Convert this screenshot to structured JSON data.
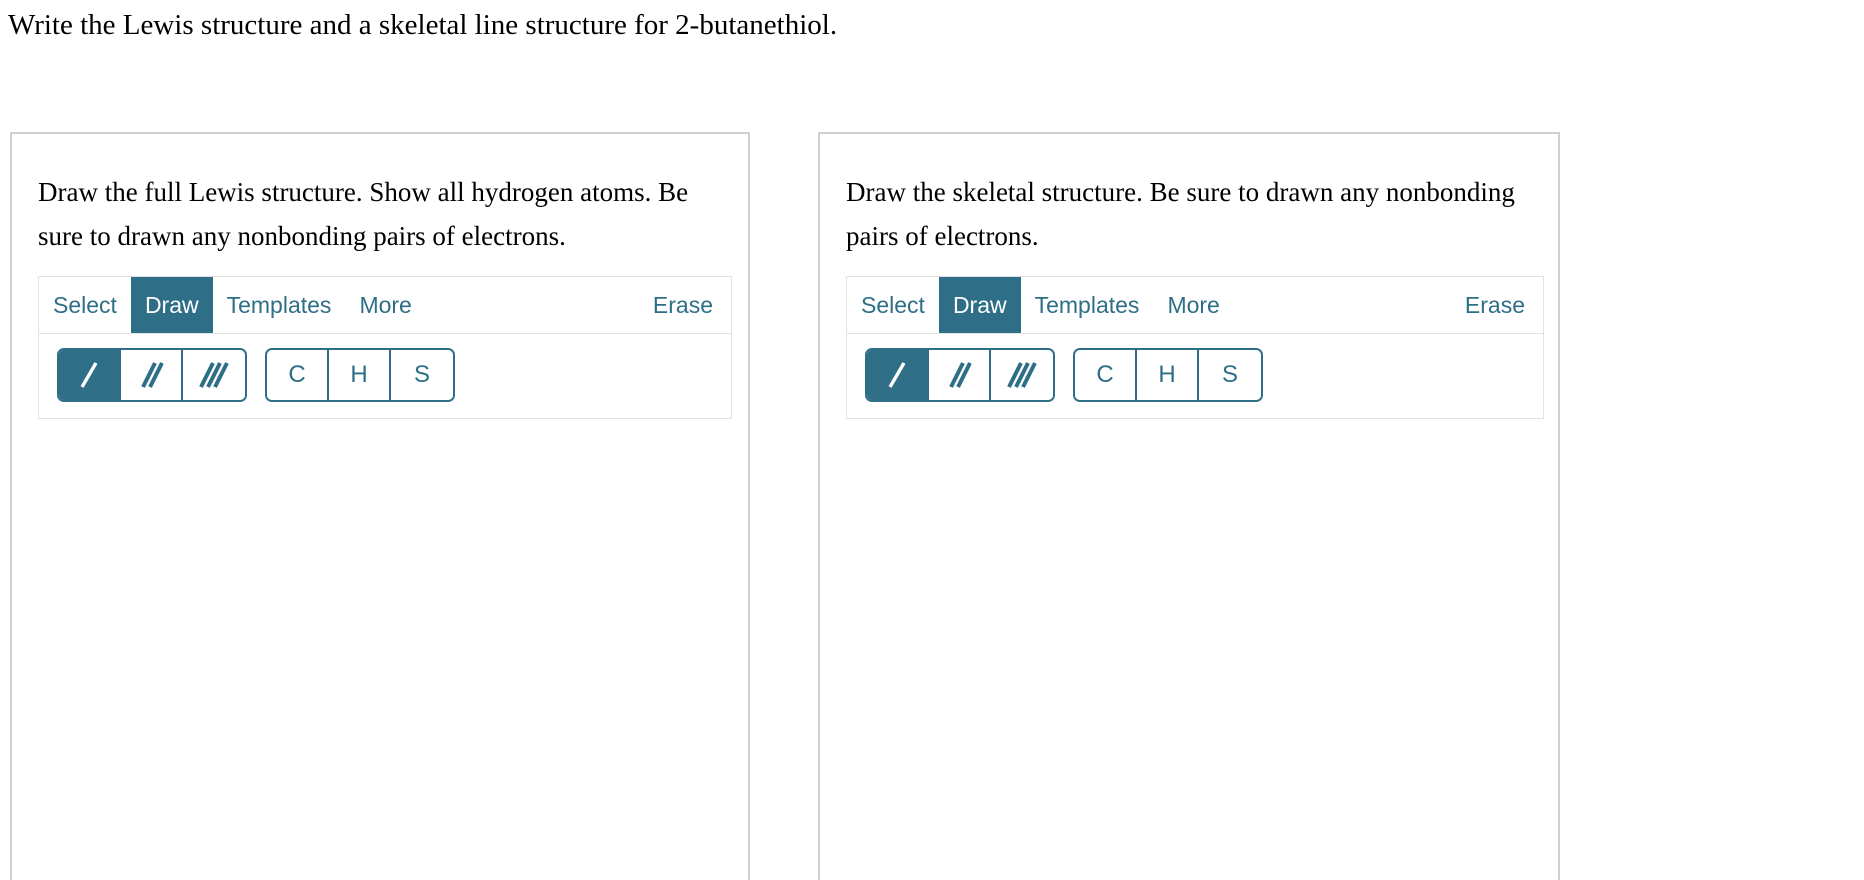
{
  "question": "Write the Lewis structure and a skeletal line structure for 2-butanethiol.",
  "theme": {
    "accent": "#2e6f87",
    "panel_border": "#cfcfcf",
    "toolbar_border": "#e2e2e2",
    "text": "#000000",
    "active_tab_text": "#ffffff"
  },
  "panels": [
    {
      "id": "lewis",
      "instructions": "Draw the full Lewis structure. Show all hydrogen atoms. Be sure to drawn any nonbonding pairs of electrons.",
      "editor": {
        "tabs": [
          {
            "label": "Select",
            "active": false
          },
          {
            "label": "Draw",
            "active": true
          },
          {
            "label": "Templates",
            "active": false
          },
          {
            "label": "More",
            "active": false
          }
        ],
        "erase_label": "Erase",
        "bond_tools": [
          {
            "icon": "single-bond-icon",
            "label": "Single bond",
            "active": true
          },
          {
            "icon": "double-bond-icon",
            "label": "Double bond",
            "active": false
          },
          {
            "icon": "triple-bond-icon",
            "label": "Triple bond",
            "active": false
          }
        ],
        "element_buttons": [
          "C",
          "H",
          "S"
        ]
      }
    },
    {
      "id": "skeletal",
      "instructions": "Draw the skeletal structure. Be sure to drawn any nonbonding pairs of electrons.",
      "editor": {
        "tabs": [
          {
            "label": "Select",
            "active": false
          },
          {
            "label": "Draw",
            "active": true
          },
          {
            "label": "Templates",
            "active": false
          },
          {
            "label": "More",
            "active": false
          }
        ],
        "erase_label": "Erase",
        "bond_tools": [
          {
            "icon": "single-bond-icon",
            "label": "Single bond",
            "active": true
          },
          {
            "icon": "double-bond-icon",
            "label": "Double bond",
            "active": false
          },
          {
            "icon": "triple-bond-icon",
            "label": "Triple bond",
            "active": false
          }
        ],
        "element_buttons": [
          "C",
          "H",
          "S"
        ]
      }
    }
  ]
}
